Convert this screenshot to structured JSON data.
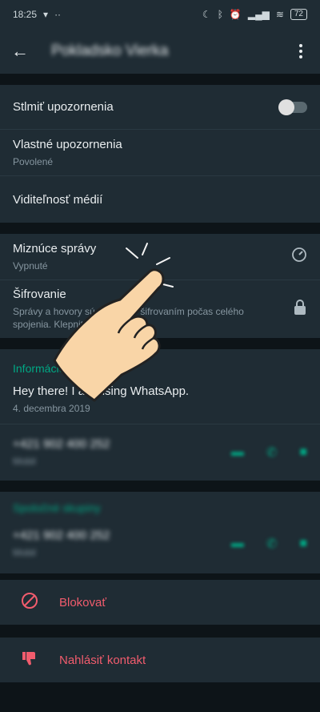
{
  "status_bar": {
    "time": "18:25",
    "battery": "72"
  },
  "appbar": {
    "title": "Pokladsko Vierka"
  },
  "settings": {
    "mute": {
      "label": "Stlmiť upozornenia"
    },
    "custom_notifications": {
      "label": "Vlastné upozornenia",
      "sub": "Povolené"
    },
    "media_visibility": {
      "label": "Viditeľnosť médií"
    },
    "disappearing": {
      "label": "Miznúce správy",
      "sub": "Vypnuté"
    },
    "encryption": {
      "label": "Šifrovanie",
      "sub": "Správy a hovory sú chránené šifrovaním počas celého spojenia. Klepnite"
    }
  },
  "info": {
    "heading": "Informácie",
    "about": "Hey there! I am using WhatsApp.",
    "date": "4. decembra 2019",
    "phone": "+421 902 400 252",
    "phone_type": "Mobil"
  },
  "group": {
    "heading": "Spoločné skupiny",
    "phone": "+421 902 400 252",
    "phone_type": "Mobil"
  },
  "actions": {
    "block": "Blokovať",
    "report": "Nahlásiť kontakt"
  },
  "colors": {
    "accent": "#00a884",
    "danger": "#f15c6d",
    "surface": "#1f2c34",
    "background": "#0d1418"
  }
}
